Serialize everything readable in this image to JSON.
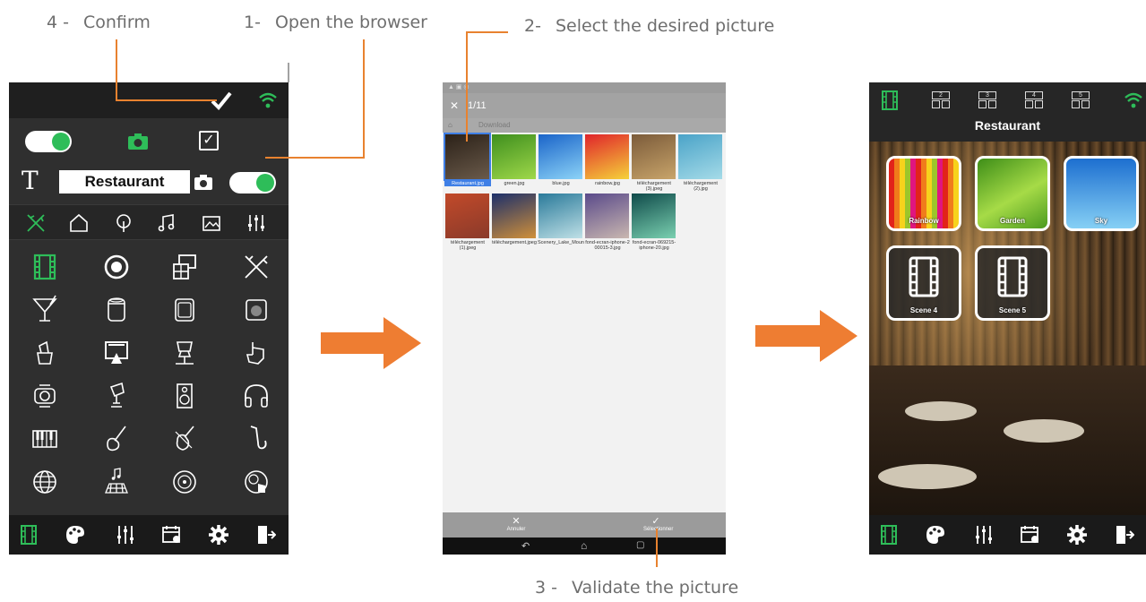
{
  "steps": {
    "confirm": {
      "num": "4 -",
      "text": "Confirm"
    },
    "open_browser": {
      "num": "1-",
      "text": "Open the browser"
    },
    "select_picture": {
      "num": "2-",
      "text": "Select the desired picture"
    },
    "validate_picture": {
      "num": "3 -",
      "text": "Validate the picture"
    }
  },
  "colors": {
    "accent_green": "#2ebd59",
    "callout_orange": "#e8822f",
    "arrow_orange": "#ee7d32"
  },
  "editor": {
    "room_name": "Restaurant",
    "toggles": {
      "top_left_on": true,
      "photo_toggle_on": true
    },
    "checkbox_checked": true,
    "category_icons": [
      "bar-icon",
      "home-icon",
      "tree-icon",
      "music-icon",
      "picture-icon",
      "equalizer-icon"
    ],
    "grid_icons": [
      "film-icon",
      "target-icon",
      "screens-icon",
      "bar-icon",
      "cocktail-icon",
      "cylinder-icon",
      "tv-cabinet-icon",
      "speaker-grill-icon",
      "ice-cream-icon",
      "projector-screen-icon",
      "lounge-icon",
      "hand-pointer-icon",
      "lamp-icon",
      "spotlight-icon",
      "speaker-icon",
      "headphones-icon",
      "piano-icon",
      "guitar-icon",
      "violin-icon",
      "saxophone-icon",
      "globe-icon",
      "dancefloor-icon",
      "vinyl-icon",
      "dj-icon"
    ],
    "bottom_icons": [
      "scenes-icon",
      "palette-icon",
      "equalizer-icon",
      "calendar-icon",
      "settings-icon",
      "exit-icon"
    ]
  },
  "browser": {
    "counter": "1/11",
    "breadcrumb": "Download",
    "files": [
      {
        "name": "Restaurant.jpg",
        "color_a": "#2b2118",
        "color_b": "#6a5a4a"
      },
      {
        "name": "green.jpg",
        "color_a": "#3f8f1e",
        "color_b": "#9fd84a"
      },
      {
        "name": "blue.jpg",
        "color_a": "#1a64c9",
        "color_b": "#8cd3f7"
      },
      {
        "name": "rainbow.jpg",
        "color_a": "#e0242b",
        "color_b": "#f5d23a"
      },
      {
        "name": "téléchargement (3).jpeg",
        "color_a": "#7b5b3a",
        "color_b": "#c8a46a"
      },
      {
        "name": "téléchargement (2).jpg",
        "color_a": "#4aa3c8",
        "color_b": "#a5dbe8"
      },
      {
        "name": "téléchargement (1).jpeg",
        "color_a": "#c24a2a",
        "color_b": "#8a3a2a"
      },
      {
        "name": "téléchargement.jpeg",
        "color_a": "#1c2f6a",
        "color_b": "#d0903a"
      },
      {
        "name": "Scenery_Lake_Mountains_Canada_Par...",
        "color_a": "#2a7a9a",
        "color_b": "#bfe0e6"
      },
      {
        "name": "fond-ecran-iphone-2 00015-3.jpg",
        "color_a": "#5a4a8a",
        "color_b": "#c9b7b0"
      },
      {
        "name": "fond-ecran-069215-iphone-20.jpg",
        "color_a": "#0f4a4a",
        "color_b": "#7ad0b0"
      }
    ],
    "cancel_label": "Annuler",
    "select_label": "Sélectionner"
  },
  "result": {
    "room_name": "Restaurant",
    "scene_tabs": [
      "2",
      "3",
      "4",
      "5"
    ],
    "tiles": [
      {
        "label": "Rainbow",
        "kind": "rainbow"
      },
      {
        "label": "Garden",
        "kind": "green"
      },
      {
        "label": "Sky",
        "kind": "blue"
      },
      {
        "label": "Scene 4",
        "kind": "film"
      },
      {
        "label": "Scene 5",
        "kind": "film"
      }
    ]
  }
}
